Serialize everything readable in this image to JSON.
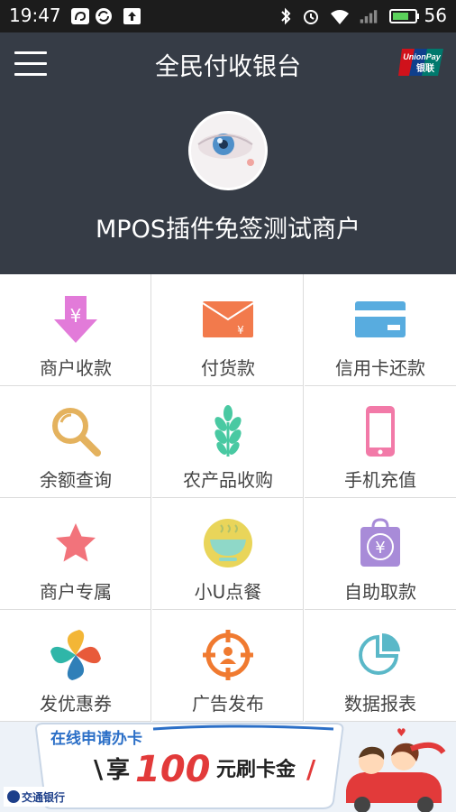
{
  "status_bar": {
    "time": "19:47",
    "battery": "56"
  },
  "header": {
    "title": "全民付收银台",
    "merchant_name": "MPOS插件免签测试商户"
  },
  "menu": [
    {
      "label": "商户收款",
      "icon": "yuan-download-icon",
      "color": "#e07ad8"
    },
    {
      "label": "付货款",
      "icon": "envelope-icon",
      "color": "#f07a4e"
    },
    {
      "label": "信用卡还款",
      "icon": "credit-card-icon",
      "color": "#5aaee0"
    },
    {
      "label": "余额查询",
      "icon": "magnifier-icon",
      "color": "#e2b05c"
    },
    {
      "label": "农产品收购",
      "icon": "wheat-icon",
      "color": "#49c9a2"
    },
    {
      "label": "手机充值",
      "icon": "phone-icon",
      "color": "#f07aa8"
    },
    {
      "label": "商户专属",
      "icon": "star-icon",
      "color": "#f2727a"
    },
    {
      "label": "小U点餐",
      "icon": "bowl-icon",
      "color": "#e8d25a"
    },
    {
      "label": "自助取款",
      "icon": "yuan-bag-icon",
      "color": "#a98ad8"
    },
    {
      "label": "发优惠券",
      "icon": "pinwheel-icon",
      "color": "#e85a3a"
    },
    {
      "label": "广告发布",
      "icon": "target-icon",
      "color": "#f07a30"
    },
    {
      "label": "数据报表",
      "icon": "pie-chart-icon",
      "color": "#5ab8c8"
    }
  ],
  "banner": {
    "line1": "在线申请办卡",
    "prefix": "享",
    "amount": "100",
    "suffix": "元刷卡金",
    "bank": "交通银行"
  }
}
